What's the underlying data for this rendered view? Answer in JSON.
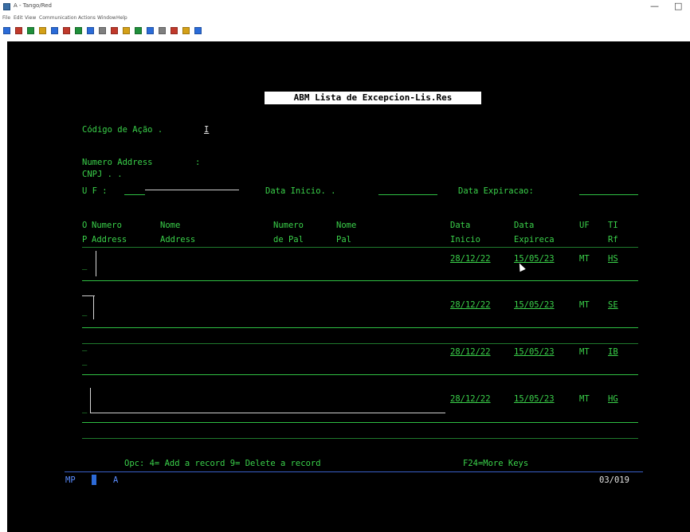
{
  "window": {
    "title": "A - Tango/Red",
    "min_label": "—",
    "max_label": "□"
  },
  "menu": [
    "File",
    "Edit",
    "View",
    "Communication",
    "Actions",
    "Window",
    "Help"
  ],
  "toolbar_icon_colors": [
    "#2a6bd8",
    "#c0392b",
    "#1f8f3a",
    "#d4a017",
    "#2a6bd8",
    "#c0392b",
    "#1f8f3a",
    "#2a6bd8",
    "#7f7f7f",
    "#c0392b",
    "#d4a017",
    "#1f8f3a",
    "#2a6bd8",
    "#7f7f7f",
    "#c0392b",
    "#d4a017",
    "#2a6bd8"
  ],
  "terminal": {
    "screen_title": "ABM Lista de Excepcion-Lis.Res",
    "fields": {
      "codigo_label": "Código de Ação .",
      "codigo_value": "I",
      "numero_address_label": "Numero Address",
      "numero_address_colon": ":",
      "cnpj_label": "CNPJ . .",
      "uf_label": "U F :",
      "data_inicio_label": "Data Inicio. .",
      "data_expiracao_label": "Data Expiracao:"
    },
    "columns": {
      "op_1": "O",
      "op_2": "P",
      "numero_address_1": "Numero",
      "numero_address_2": "Address",
      "nome_address_1": "Nome",
      "nome_address_2": "Address",
      "numero_pal_1": "Numero",
      "numero_pal_2": "de Pal",
      "nome_pal_1": "Nome",
      "nome_pal_2": "Pal",
      "data_inicio_1": "Data",
      "data_inicio_2": "Inicio",
      "data_expira_1": "Data",
      "data_expira_2": "Expireca",
      "uf_1": "UF",
      "ti_1": "TI",
      "ti_2": "Rf"
    },
    "records": [
      {
        "data_inicio": "28/12/22",
        "data_expira": "15/05/23",
        "uf": "MT",
        "ti": "HS"
      },
      {
        "data_inicio": "28/12/22",
        "data_expira": "15/05/23",
        "uf": "MT",
        "ti": "SE"
      },
      {
        "data_inicio": "28/12/22",
        "data_expira": "15/05/23",
        "uf": "MT",
        "ti": "IB"
      },
      {
        "data_inicio": "28/12/22",
        "data_expira": "15/05/23",
        "uf": "MT",
        "ti": "HG"
      }
    ],
    "footer": {
      "keys": "Opc: 4= Add a record  9= Delete a record",
      "more_keys": "F24=More Keys"
    },
    "status": {
      "mode": "MP",
      "indicator": "A",
      "position": "03/019"
    }
  }
}
